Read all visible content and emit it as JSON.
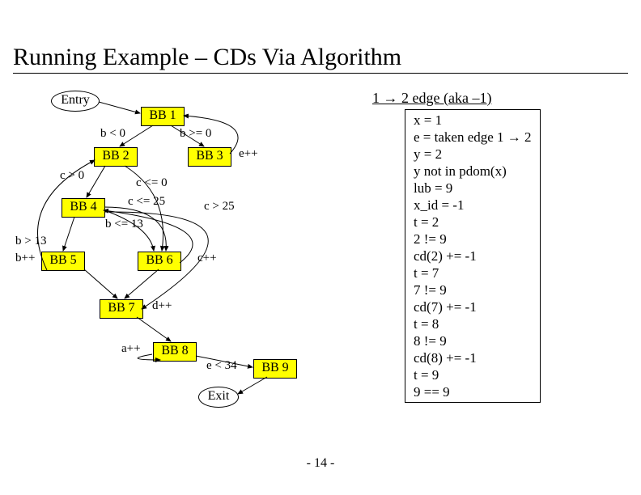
{
  "title": "Running Example – CDs Via Algorithm",
  "nodes": {
    "entry": "Entry",
    "bb1": "BB 1",
    "bb2": "BB 2",
    "bb3": "BB 3",
    "bb4": "BB 4",
    "bb5": "BB 5",
    "bb6": "BB 6",
    "bb7": "BB 7",
    "bb8": "BB 8",
    "bb9": "BB 9",
    "exit": "Exit"
  },
  "edges": {
    "b_lt_0": "b < 0",
    "b_ge_0": "b >= 0",
    "e_pp": "e++",
    "c_gt_0": "c > 0",
    "c_le_0": "c <= 0",
    "c_le_25": "c <= 25",
    "c_gt_25": "c > 25",
    "b_le_13": "b <= 13",
    "b_gt_13": "b > 13",
    "b_pp": "b++",
    "c_pp": "c++",
    "d_pp": "d++",
    "a_pp": "a++",
    "e_lt_34": "e < 34"
  },
  "page": "- 14 -",
  "algo": {
    "header": "1 → 2 edge (aka –1)",
    "lines": [
      "x = 1",
      "e = taken edge 1 → 2",
      "y = 2",
      "y not in pdom(x)",
      "lub = 9",
      "x_id = -1",
      "t = 2",
      "2 != 9",
      "cd(2) += -1",
      "t = 7",
      "7 != 9",
      "cd(7) += -1",
      "t = 8",
      "8 != 9",
      "cd(8) += -1",
      "t = 9",
      "9 == 9"
    ]
  },
  "chart_data": {
    "type": "table",
    "title": "Control-flow graph edges",
    "edges_adj": [
      {
        "from": "Entry",
        "to": "BB1",
        "label": ""
      },
      {
        "from": "BB1",
        "to": "BB2",
        "label": "b < 0"
      },
      {
        "from": "BB1",
        "to": "BB3",
        "label": "b >= 0"
      },
      {
        "from": "BB3",
        "to": "BB1",
        "label": "e++"
      },
      {
        "from": "BB2",
        "to": "BB4",
        "label": "c > 0"
      },
      {
        "from": "BB2",
        "to": "BB6",
        "label": "c <= 0"
      },
      {
        "from": "BB4",
        "to": "BB6",
        "label": "c <= 25"
      },
      {
        "from": "BB4",
        "to": "BB7",
        "label": "c > 25"
      },
      {
        "from": "BB4",
        "to": "BB5",
        "label": "b > 13"
      },
      {
        "from": "BB4",
        "to": "BB6",
        "label": "b <= 13"
      },
      {
        "from": "BB5",
        "to": "BB2",
        "label": "b++"
      },
      {
        "from": "BB6",
        "to": "BB4",
        "label": "c++"
      },
      {
        "from": "BB7",
        "to": "BB8",
        "label": "d++"
      },
      {
        "from": "BB8",
        "to": "BB8",
        "label": "a++"
      },
      {
        "from": "BB8",
        "to": "BB9",
        "label": "e < 34"
      },
      {
        "from": "BB9",
        "to": "Exit",
        "label": ""
      }
    ]
  }
}
